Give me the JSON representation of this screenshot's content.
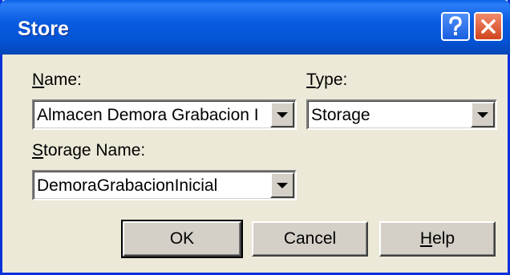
{
  "window": {
    "title": "Store",
    "help_icon": "question-mark-icon",
    "close_icon": "close-x-icon",
    "colors": {
      "titlebar": "#0a5ce0",
      "close": "#d1451f",
      "face": "#ece9d8"
    }
  },
  "form": {
    "name_label_first": "N",
    "name_label_rest": "ame:",
    "name_value": "Almacen Demora Grabacion I",
    "type_label_first": "T",
    "type_label_rest": "ype:",
    "type_value": "Storage",
    "storage_name_label_first": "S",
    "storage_name_label_rest": "torage Name:",
    "storage_name_value": "DemoraGrabacionInicial"
  },
  "buttons": {
    "ok": "OK",
    "cancel": "Cancel",
    "help_first": "H",
    "help_rest": "elp"
  }
}
